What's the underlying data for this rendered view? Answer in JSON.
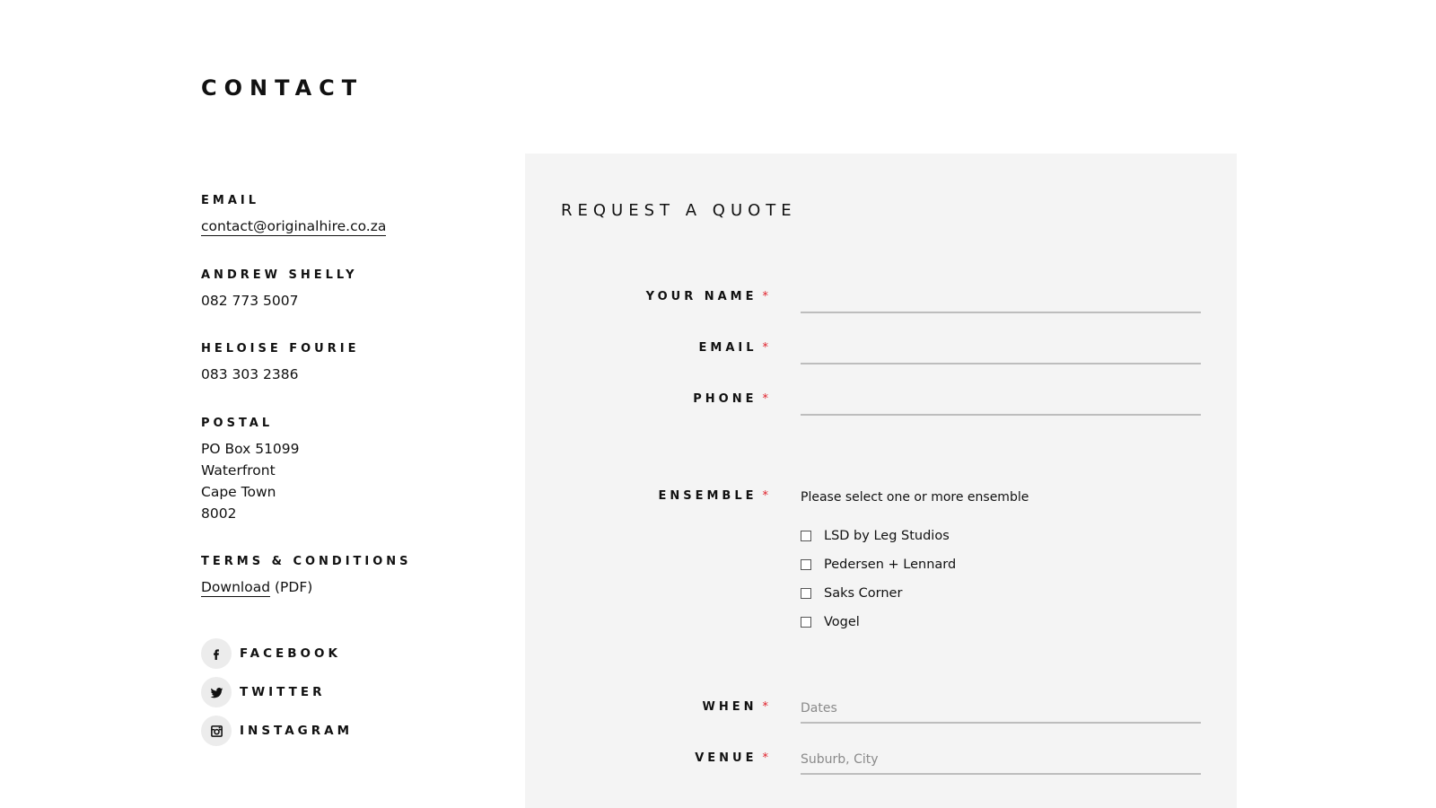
{
  "page": {
    "title": "CONTACT"
  },
  "contact": {
    "email_label": "EMAIL",
    "email_value": "contact@originalhire.co.za",
    "person1_label": "ANDREW SHELLY",
    "person1_phone": "082 773 5007",
    "person2_label": "HELOISE FOURIE",
    "person2_phone": "083 303 2386",
    "postal_label": "POSTAL",
    "postal_lines": [
      "PO Box 51099",
      "Waterfront",
      "Cape Town",
      "8002"
    ],
    "terms_label": "TERMS & CONDITIONS",
    "terms_link": "Download",
    "terms_suffix": "(PDF)"
  },
  "social": [
    {
      "label": "FACEBOOK",
      "icon": "facebook-icon"
    },
    {
      "label": "TWITTER",
      "icon": "twitter-icon"
    },
    {
      "label": "INSTAGRAM",
      "icon": "instagram-icon"
    }
  ],
  "form": {
    "title": "REQUEST A QUOTE",
    "required_mark": "*",
    "name_label": "YOUR NAME",
    "email_label": "EMAIL",
    "phone_label": "PHONE",
    "ensemble_label": "ENSEMBLE",
    "ensemble_hint": "Please select one or more ensemble",
    "ensemble_options": [
      "LSD by Leg Studios",
      "Pedersen + Lennard",
      "Saks Corner",
      "Vogel"
    ],
    "when_label": "WHEN",
    "when_placeholder": "Dates",
    "venue_label": "VENUE",
    "venue_placeholder": "Suburb, City"
  },
  "colors": {
    "required": "#e0202a",
    "panel_bg": "#f4f4f4",
    "input_underline": "#bdbdbd",
    "social_circle": "#ececec"
  }
}
